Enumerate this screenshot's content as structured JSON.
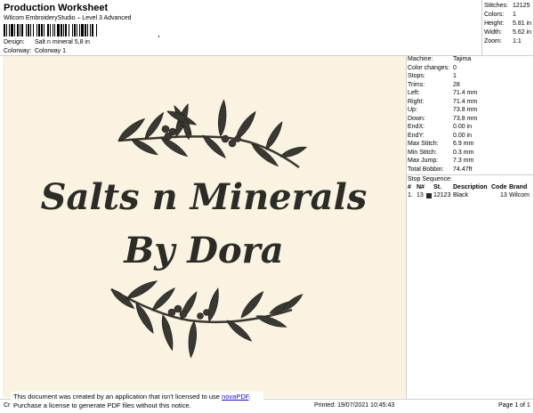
{
  "header": {
    "title": "Production Worksheet",
    "subtitle": "Wilcom EmbroideryStudio – Level 3 Advanced",
    "barcode_suffix": ","
  },
  "design": {
    "label": "Design:",
    "value": "Salt n mineral 5,8 in"
  },
  "colorway": {
    "label": "Colorway:",
    "value": "Colorway 1"
  },
  "stats": [
    {
      "label": "Stitches:",
      "value": "12125"
    },
    {
      "label": "Colors:",
      "value": "1"
    },
    {
      "label": "Height:",
      "value": "5.81 in"
    },
    {
      "label": "Width:",
      "value": "5.62 in"
    },
    {
      "label": "Zoom:",
      "value": "1:1"
    }
  ],
  "machine_info": [
    {
      "label": "Machine:",
      "value": "Tajima"
    },
    {
      "label": "Color changes:",
      "value": "0"
    },
    {
      "label": "Stops:",
      "value": "1"
    },
    {
      "label": "Trims:",
      "value": "28"
    },
    {
      "label": "Left:",
      "value": "71.4 mm"
    },
    {
      "label": "Right:",
      "value": "71.4 mm"
    },
    {
      "label": "Up:",
      "value": "73.8 mm"
    },
    {
      "label": "Down:",
      "value": "73.8 mm"
    },
    {
      "label": "EndX:",
      "value": "0.00 in"
    },
    {
      "label": "EndY:",
      "value": "0.00 in"
    },
    {
      "label": "Max Stitch:",
      "value": "6.9 mm"
    },
    {
      "label": "Min Stitch:",
      "value": "0.3 mm"
    },
    {
      "label": "Max Jump:",
      "value": "7.3 mm"
    },
    {
      "label": "Total Bobbin:",
      "value": "74.47ft"
    }
  ],
  "stop_sequence": {
    "title": "Stop Sequence:",
    "headers": {
      "num": "#",
      "n": "N#",
      "st": "St.",
      "desc": "Description",
      "code": "Code",
      "brand": "Brand"
    },
    "rows": [
      {
        "num": "1.",
        "n": "13",
        "st": "12123",
        "desc": "Black",
        "code": "13",
        "brand": "Wilcom"
      }
    ]
  },
  "artwork": {
    "line1": "Salts n Minerals",
    "line2": "By Dora",
    "thread_color": "#2b2b27",
    "leaf_color": "#3a3832",
    "fabric_color": "#fbf3e1"
  },
  "footer": {
    "left": "Cr",
    "printed": "Printed: 19/07/2021 10:45:43",
    "page": "Page 1 of 1"
  },
  "notice": {
    "line1_pre": "This document was created by an application that isn't licensed to use ",
    "link": "novaPDF",
    "line1_post": ".",
    "line2": "Purchase a license to generate PDF files without this notice."
  }
}
